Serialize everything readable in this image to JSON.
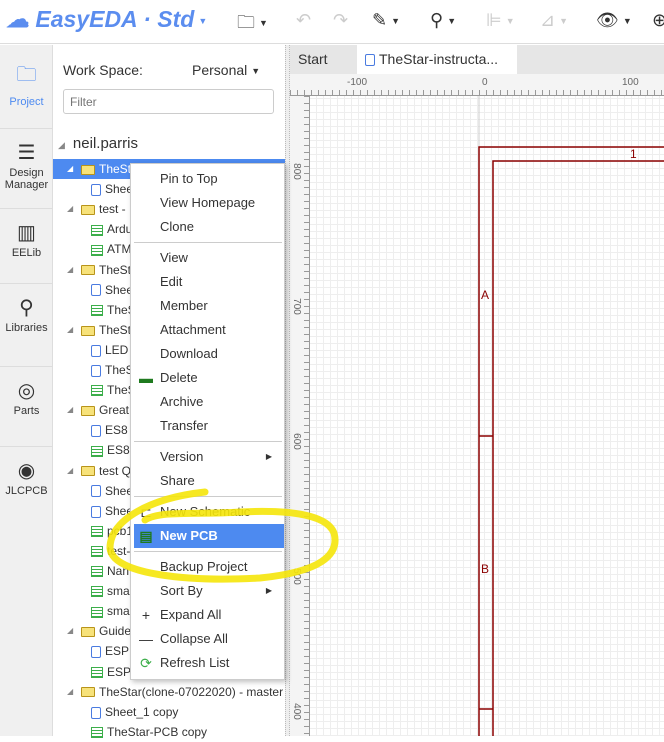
{
  "toolbar": {
    "logo": "EasyEDA · Std",
    "icons": [
      "cloud-logo-icon",
      "folder-icon",
      "undo-icon",
      "redo-icon",
      "pencil-icon",
      "location-pin-icon",
      "align-icon",
      "measure-icon",
      "eye-icon",
      "zoom-in-icon"
    ]
  },
  "rail": {
    "items": [
      {
        "label": "Project",
        "icon": "project-folder-icon",
        "active": true
      },
      {
        "label": "Design Manager",
        "icon": "design-manager-icon"
      },
      {
        "label": "EELib",
        "icon": "chip-icon"
      },
      {
        "label": "Libraries",
        "icon": "magnifier-chip-icon"
      },
      {
        "label": "Parts",
        "icon": "lcsc-icon"
      },
      {
        "label": "JLCPCB",
        "icon": "jlc-icon"
      }
    ]
  },
  "panel": {
    "workspace_label": "Work Space:",
    "workspace_value": "Personal",
    "filter_placeholder": "Filter",
    "root": "neil.parris",
    "tree": [
      {
        "type": "folder",
        "label": "TheSt",
        "selected": true
      },
      {
        "type": "sch",
        "label": "Shee"
      },
      {
        "type": "folder",
        "label": "test - "
      },
      {
        "type": "pcb",
        "label": "Ardu"
      },
      {
        "type": "pcb",
        "label": "ATM"
      },
      {
        "type": "folder",
        "label": "TheSt"
      },
      {
        "type": "sch",
        "label": "Shee"
      },
      {
        "type": "pcb",
        "label": "TheS"
      },
      {
        "type": "folder",
        "label": "TheSt"
      },
      {
        "type": "sch",
        "label": "LED"
      },
      {
        "type": "sch",
        "label": "TheS"
      },
      {
        "type": "pcb",
        "label": "TheS"
      },
      {
        "type": "folder",
        "label": "Great"
      },
      {
        "type": "sch",
        "label": "ES8"
      },
      {
        "type": "pcb",
        "label": "ES8"
      },
      {
        "type": "folder",
        "label": "test Q"
      },
      {
        "type": "sch",
        "label": "Shee"
      },
      {
        "type": "sch",
        "label": "Shee"
      },
      {
        "type": "pcb",
        "label": "pcb1"
      },
      {
        "type": "pcb",
        "label": "test-"
      },
      {
        "type": "pcb",
        "label": "Nan"
      },
      {
        "type": "pcb",
        "label": "sma"
      },
      {
        "type": "pcb",
        "label": "sma"
      },
      {
        "type": "folder",
        "label": "Guide"
      },
      {
        "type": "sch",
        "label": "ESP"
      },
      {
        "type": "pcb",
        "label": "ESP"
      },
      {
        "type": "folder",
        "label": "TheStar(clone-07022020) - master"
      },
      {
        "type": "sch",
        "label": "Sheet_1 copy"
      },
      {
        "type": "pcb",
        "label": "TheStar-PCB copy"
      }
    ]
  },
  "tabs": [
    {
      "label": "Start"
    },
    {
      "label": "TheStar-instructa...",
      "icon": "schematic-icon",
      "active": true
    }
  ],
  "ruler": {
    "x_labels": [
      "-100",
      "0",
      "100"
    ],
    "y_labels": [
      "800",
      "700",
      "600",
      "500",
      "400"
    ]
  },
  "sheet": {
    "col_label": "1",
    "row_labels": [
      "A",
      "B"
    ],
    "frame_color": "#8b0000"
  },
  "context_menu": {
    "items": [
      {
        "label": "Pin to Top"
      },
      {
        "label": "View Homepage"
      },
      {
        "label": "Clone"
      },
      {
        "sep": true
      },
      {
        "label": "View"
      },
      {
        "label": "Edit"
      },
      {
        "label": "Member"
      },
      {
        "label": "Attachment"
      },
      {
        "label": "Download"
      },
      {
        "label": "Delete",
        "icon": "delete-green-icon"
      },
      {
        "label": "Archive"
      },
      {
        "label": "Transfer"
      },
      {
        "sep": true
      },
      {
        "label": "Version",
        "submenu": true
      },
      {
        "label": "Share"
      },
      {
        "sep": true
      },
      {
        "label": "New Schematic",
        "icon": "schematic-icon"
      },
      {
        "label": "New PCB",
        "icon": "pcb-icon",
        "highlighted": true
      },
      {
        "sep": true
      },
      {
        "label": "Backup Project"
      },
      {
        "label": "Sort By",
        "submenu": true
      },
      {
        "label": "Expand All",
        "icon": "plus-icon"
      },
      {
        "label": "Collapse All",
        "icon": "minus-icon"
      },
      {
        "label": "Refresh List",
        "icon": "refresh-icon"
      }
    ]
  },
  "colors": {
    "accent": "#4d8af0",
    "annotation": "#f5e50a"
  }
}
